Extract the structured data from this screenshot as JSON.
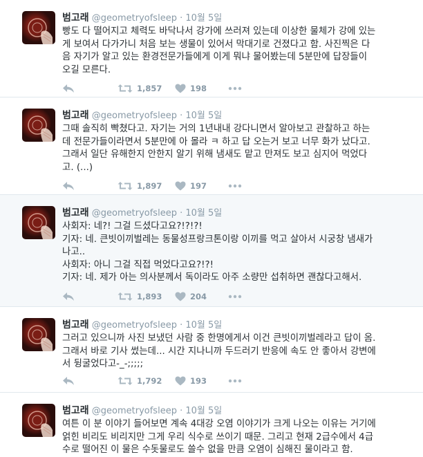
{
  "author": {
    "name": "범고래",
    "handle": "@geometryofsleep",
    "dot": "·"
  },
  "tweets": [
    {
      "time": "10월 5일",
      "lines": [
        "빵도 다 떨어지고 체력도 바닥나서 강가에 쓰러져 있는데 이상한 물체가 강에 있는",
        "게 보여서 다가가니 처음 보는 생물이 있어서 막대기로 건졌다고 함. 사진찍은 다",
        "음 자기가 알고 있는 환경전문가들에게 이게 뭐냐 물어봤는데 5분만에 답장들이",
        "오길 모른다."
      ],
      "retweets": "1,857",
      "likes": "198"
    },
    {
      "time": "10월 5일",
      "lines": [
        "그때 솔직히 빡쳤다고. 자기는 거의 1년내내 강다니면서 알아보고 관찰하고 하는",
        "데 전문가들이라면서 5분만에 아 몰라 ㅋ 하고 답 오는거 보고 너무 화가 났다고.",
        "그래서 일단 유해한지 안한지 알기 위해 냄새도 맡고 만져도 보고 심지어 먹었다",
        "고. (...)"
      ],
      "retweets": "1,897",
      "likes": "197"
    },
    {
      "time": "10월 5일",
      "lines": [
        "사회자: 네?! 그걸 드셨다고요?!?!?!",
        "기자: 네. 큰빗이끼벌레는 동물성프랑크톤이랑 이끼를 먹고 살아서 시궁창 냄새가",
        "나고..",
        "사회자: 아니 그걸 직접 먹었다고요?!?!",
        "기자: 네. 제가 아는 의사분께서 독이라도 아주 소량만 섭취하면 괜찮다고해서."
      ],
      "retweets": "1,893",
      "likes": "204"
    },
    {
      "time": "10월 5일",
      "lines": [
        "그러고 있으니까 사진 보냈던 사람 중 한명에게서 이건 큰빗이끼벌레라고 답이 옴.",
        "그래서 바로 기사 썼는데... 시간 지나니까 두드러기 반응에 속도 안 좋아서 강변에",
        "서 뒹굴었다고-_-;;;;;"
      ],
      "retweets": "1,792",
      "likes": "193"
    },
    {
      "time": "10월 5일",
      "lines": [
        "여튼 이 분 이야기 들어보면 계속 4대강 오염 이야기가 크게 나오는 이유는 거기에",
        "얽힌 비리도 비리지만 그게 우리 식수로 쓰이기 때문. 그리고 현재 2급수에서 4급",
        "수로 떨어진 이 물은 수돗물로도 쓸수 없을 만큼 오염이 심해진 물이라고 함."
      ]
    }
  ]
}
